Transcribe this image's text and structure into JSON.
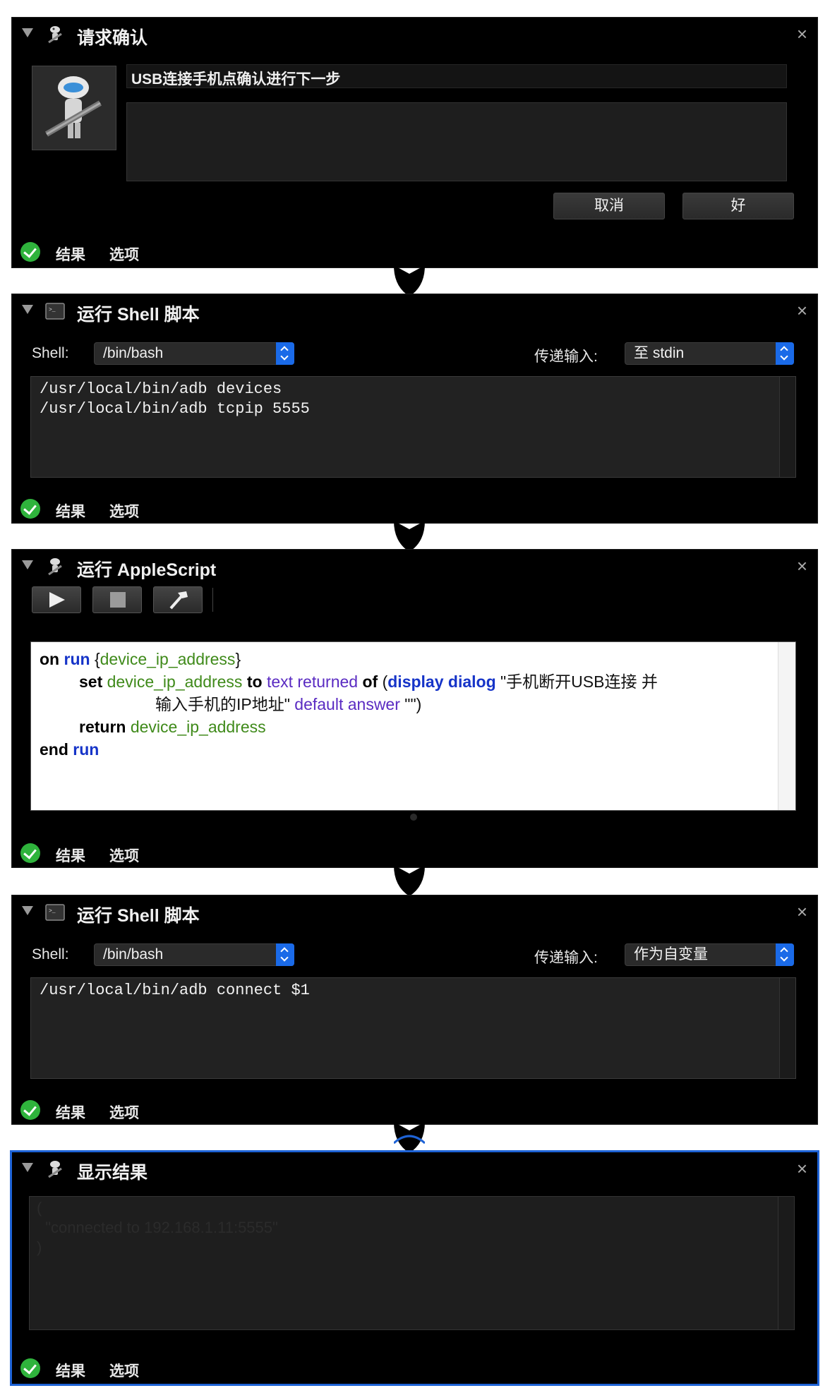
{
  "colors": {
    "accent": "#1e63d6",
    "check": "#2fb33c",
    "panel_bg": "#000000"
  },
  "footer": {
    "results": "结果",
    "options": "选项"
  },
  "close_glyph": "×",
  "panels": [
    {
      "title": "请求确认",
      "icon": "automator-robot-icon",
      "message": "USB连接手机点确认进行下一步",
      "cancel_label": "取消",
      "ok_label": "好"
    },
    {
      "title": "运行 Shell 脚本",
      "icon": "terminal-icon",
      "shell_label": "Shell:",
      "shell_value": "/bin/bash",
      "pass_label": "传递输入:",
      "pass_value": "至 stdin",
      "code": [
        "/usr/local/bin/adb devices",
        "/usr/local/bin/adb tcpip 5555"
      ]
    },
    {
      "title": "运行 AppleScript",
      "icon": "automator-robot-icon",
      "toolbar": [
        "run-icon",
        "stop-icon",
        "compile-hammer-icon"
      ],
      "script": {
        "line1": {
          "on": "on",
          "run": "run",
          "param_open": "{",
          "param": "device_ip_address",
          "param_close": "}"
        },
        "line2": {
          "set": "set",
          "var": "device_ip_address",
          "to": "to",
          "text_returned": "text returned",
          "of": "of",
          "paren": "(",
          "display_dialog": "display dialog",
          "prompt": "\"手机断开USB连接 并"
        },
        "line3": {
          "prompt_cont": "输入手机的IP地址\"",
          "default_answer": "default answer",
          "empty": "\"\")"
        },
        "line4": {
          "return": "return",
          "var": "device_ip_address"
        },
        "line5": {
          "end": "end",
          "run": "run"
        }
      }
    },
    {
      "title": "运行 Shell 脚本",
      "icon": "terminal-icon",
      "shell_label": "Shell:",
      "shell_value": "/bin/bash",
      "pass_label": "传递输入:",
      "pass_value": "作为自变量",
      "code": [
        "/usr/local/bin/adb connect $1"
      ]
    },
    {
      "title": "显示结果",
      "icon": "automator-robot-icon",
      "result": [
        "(",
        "  \"connected to 192.168.1.11:5555\"",
        ")"
      ]
    }
  ]
}
